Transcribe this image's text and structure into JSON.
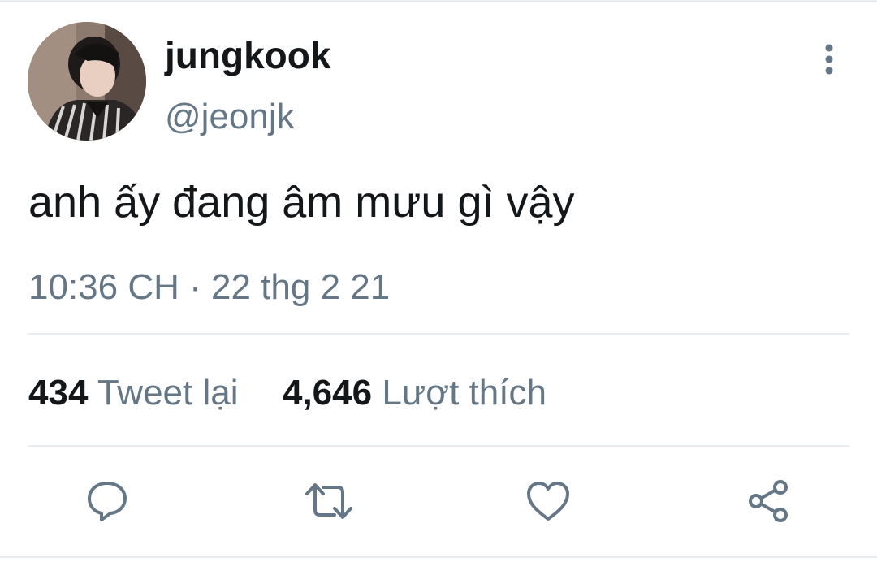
{
  "user": {
    "display_name": "jungkook",
    "handle": "@jeonjk"
  },
  "tweet": {
    "text": "anh ấy đang âm mưu gì vậy",
    "time": "10:36 CH",
    "separator": "·",
    "date": "22 thg 2 21"
  },
  "stats": {
    "retweets_count": "434",
    "retweets_label": "Tweet lại",
    "likes_count": "4,646",
    "likes_label": "Lượt thích"
  },
  "icons": {
    "more": "more-vertical-icon",
    "reply": "reply-icon",
    "retweet": "retweet-icon",
    "like": "heart-icon",
    "share": "share-icon"
  },
  "colors": {
    "primary_text": "#14171a",
    "secondary_text": "#657786",
    "divider": "#e6ecf0",
    "icon": "#657786"
  }
}
